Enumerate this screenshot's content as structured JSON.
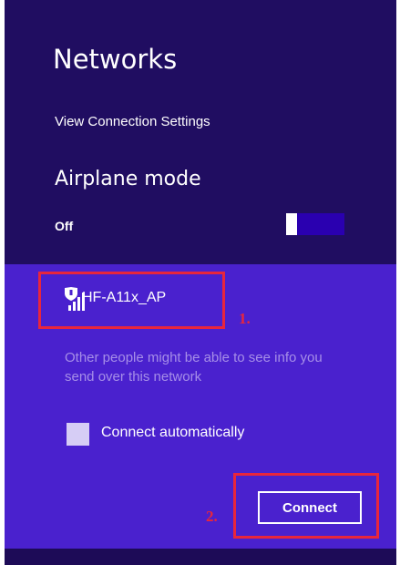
{
  "panel": {
    "title": "Networks",
    "view_settings": "View Connection Settings"
  },
  "airplane": {
    "title": "Airplane mode",
    "state": "Off",
    "enabled": false
  },
  "network": {
    "name": "HF-A11x_AP",
    "secured": true,
    "warning": "Other people might be able to see info you send over this network",
    "connect_auto_label": "Connect automatically",
    "connect_auto_checked": false,
    "connect_label": "Connect"
  },
  "annotations": {
    "step1": "1.",
    "step2": "2."
  },
  "colors": {
    "header_bg": "#200d61",
    "network_bg": "#4a21ce",
    "annotation": "#e8263c",
    "warning_text": "#a68ee8"
  }
}
